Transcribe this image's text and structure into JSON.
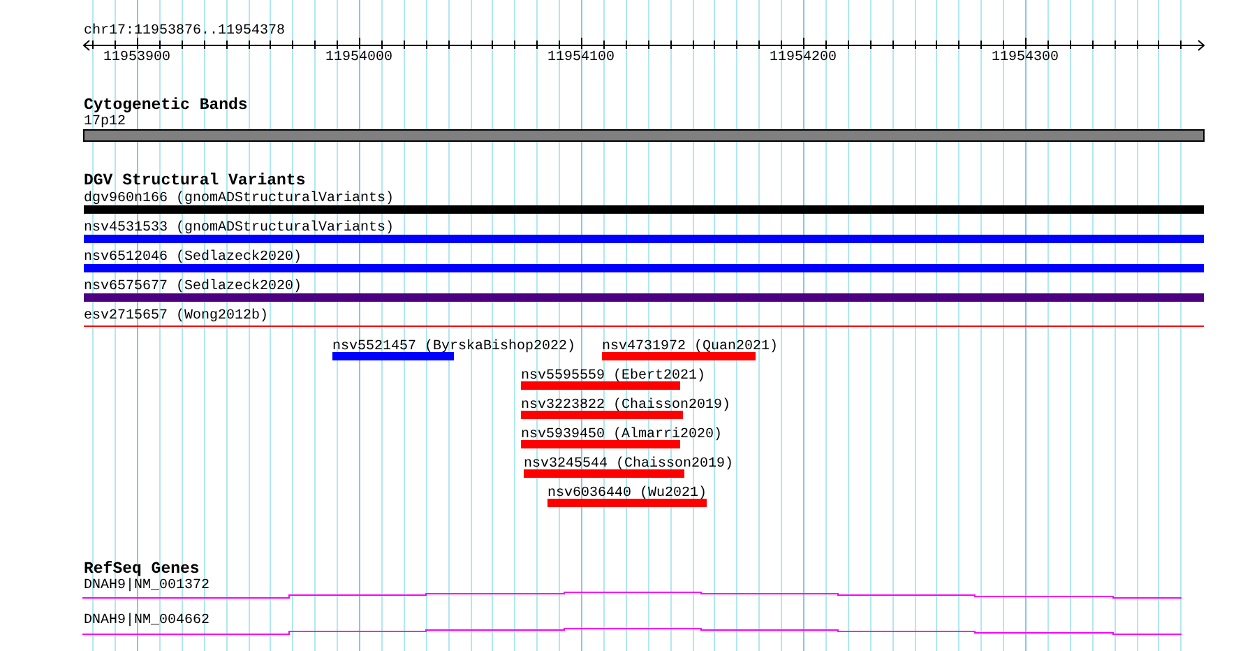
{
  "ruler": {
    "range": "chr17:11953876..11954378",
    "ticks": [
      "11953900",
      "11954000",
      "11954100",
      "11954200",
      "11954300"
    ]
  },
  "tracks": [
    {
      "title": "Cytogenetic Bands",
      "kind": "cytoband",
      "features": [
        {
          "label": "17p12",
          "color": "#808080"
        }
      ]
    },
    {
      "title": "DGV Structural Variants",
      "kind": "variants",
      "features": [
        {
          "label": "dgv960n166 (gnomADStructuralVariants)",
          "color": "#000000"
        },
        {
          "label": "nsv4531533 (gnomADStructuralVariants)",
          "color": "#0000ff"
        },
        {
          "label": "nsv6512046 (Sedlazeck2020)",
          "color": "#0000ff"
        },
        {
          "label": "nsv6575677 (Sedlazeck2020)",
          "color": "#4b0082"
        },
        {
          "label": "esv2715657 (Wong2012b)",
          "color": "#ff0000"
        },
        {
          "label": "nsv5521457 (ByrskaBishop2022)",
          "color": "#0000ff"
        },
        {
          "label": "nsv4731972 (Quan2021)",
          "color": "#ff0000"
        },
        {
          "label": "nsv5595559 (Ebert2021)",
          "color": "#ff0000"
        },
        {
          "label": "nsv3223822 (Chaisson2019)",
          "color": "#ff0000"
        },
        {
          "label": "nsv5939450 (Almarri2020)",
          "color": "#ff0000"
        },
        {
          "label": "nsv3245544 (Chaisson2019)",
          "color": "#ff0000"
        },
        {
          "label": "nsv6036440 (Wu2021)",
          "color": "#ff0000"
        }
      ]
    },
    {
      "title": "RefSeq Genes",
      "kind": "genes",
      "features": [
        {
          "label": "DNAH9|NM_001372",
          "color": "#ff00ff"
        },
        {
          "label": "DNAH9|NM_004662",
          "color": "#ff00ff"
        }
      ]
    }
  ]
}
